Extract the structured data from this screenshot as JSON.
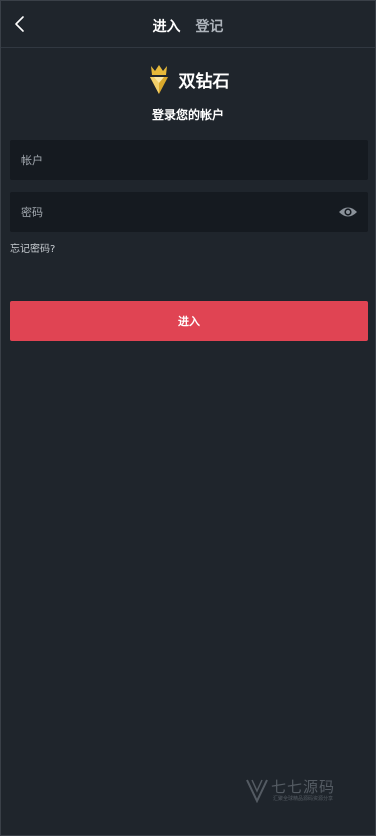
{
  "header": {
    "back_icon": "chevron-left-icon",
    "tabs": [
      {
        "label": "进入",
        "active": true
      },
      {
        "label": "登记",
        "active": false
      }
    ]
  },
  "brand": {
    "logo_icon": "diamond-crown-icon",
    "name": "双钻石",
    "subtitle": "登录您的帐户"
  },
  "form": {
    "account": {
      "value": "",
      "placeholder": "帐户"
    },
    "password": {
      "value": "",
      "placeholder": "密码",
      "toggle_icon": "eye-icon"
    },
    "forgot_label": "忘记密码?",
    "submit_label": "进入"
  },
  "watermark": {
    "text": "七七源码",
    "subtext": "汇聚全球精品源码资源分享"
  },
  "colors": {
    "background": "#1f252c",
    "input_background": "#151a20",
    "accent": "#e04453",
    "logo_gold": "#e6b93a"
  }
}
